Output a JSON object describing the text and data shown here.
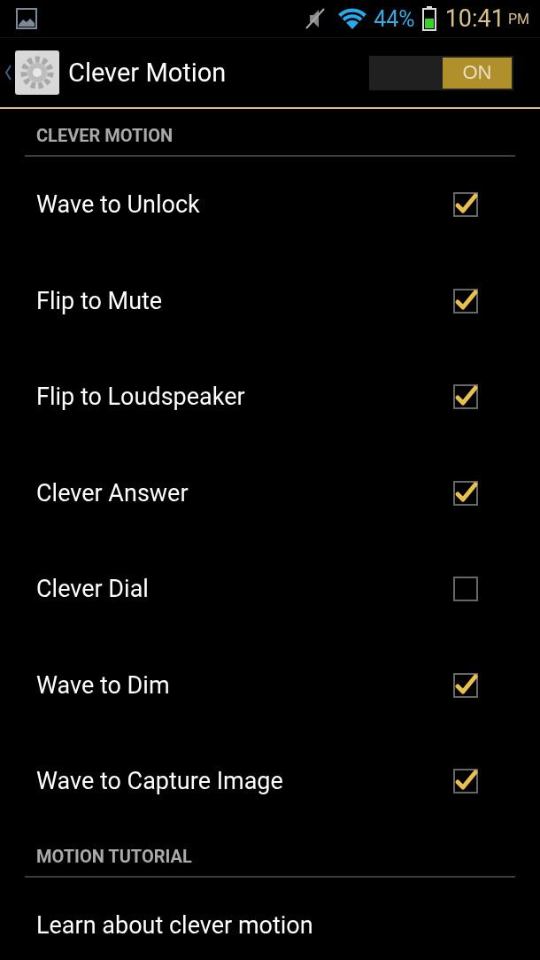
{
  "status_bar": {
    "battery": "44%",
    "time": "10:41",
    "ampm": "PM"
  },
  "action_bar": {
    "title": "Clever Motion",
    "switch": {
      "label": "ON",
      "on": true
    }
  },
  "sections": [
    {
      "title": "CLEVER MOTION",
      "items": [
        {
          "label": "Wave to Unlock",
          "kind": "checkbox",
          "checked": true
        },
        {
          "label": "Flip to Mute",
          "kind": "checkbox",
          "checked": true
        },
        {
          "label": "Flip to Loudspeaker",
          "kind": "checkbox",
          "checked": true
        },
        {
          "label": "Clever Answer",
          "kind": "checkbox",
          "checked": true
        },
        {
          "label": "Clever Dial",
          "kind": "checkbox",
          "checked": false
        },
        {
          "label": "Wave to Dim",
          "kind": "checkbox",
          "checked": true
        },
        {
          "label": "Wave to Capture Image",
          "kind": "checkbox",
          "checked": true
        }
      ]
    },
    {
      "title": "MOTION TUTORIAL",
      "items": [
        {
          "label": "Learn about clever motion",
          "kind": "link"
        }
      ]
    }
  ]
}
